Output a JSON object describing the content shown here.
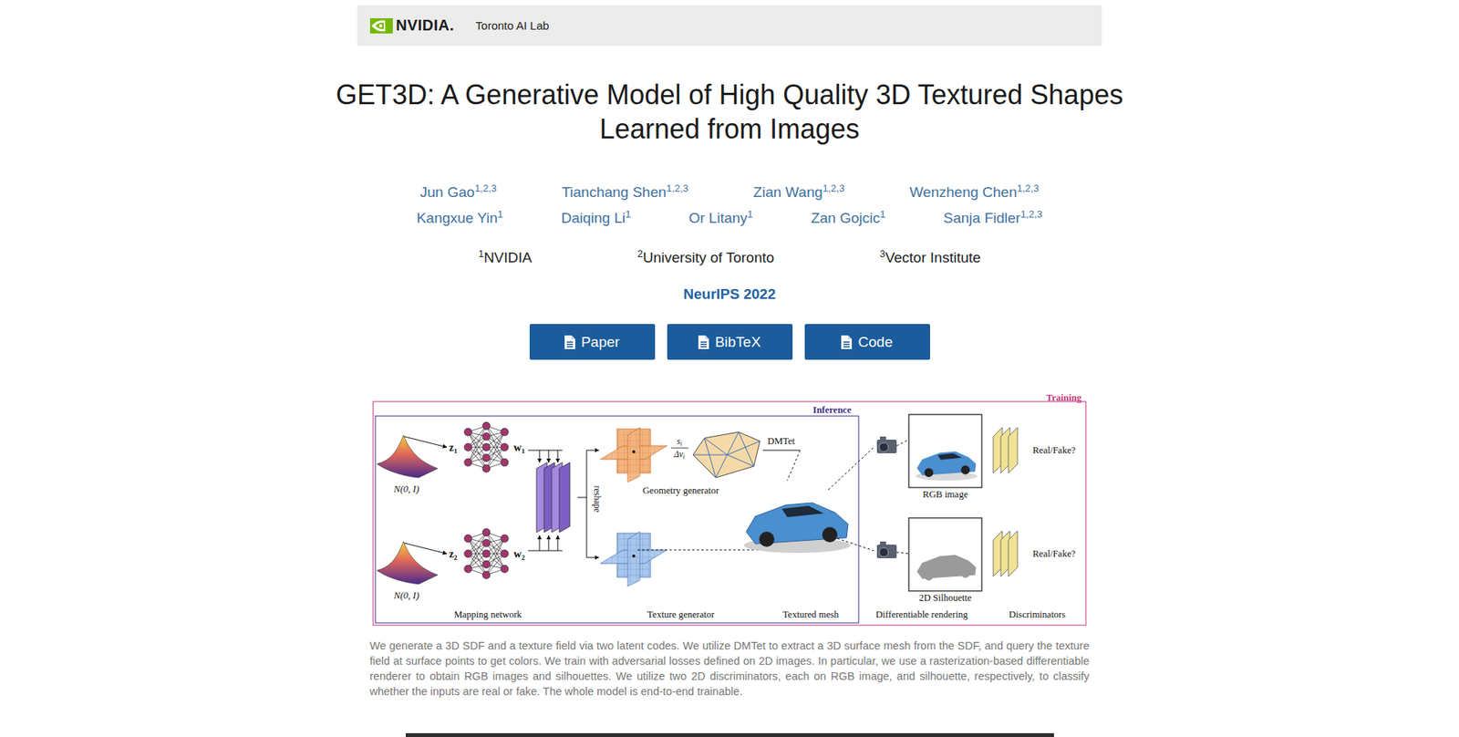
{
  "header": {
    "logo": "NVIDIA.",
    "lab": "Toronto AI Lab"
  },
  "title": "GET3D: A Generative Model of High Quality 3D Textured Shapes Learned from Images",
  "author_rows": [
    [
      {
        "name": "Jun Gao",
        "affiliations": "1,2,3"
      },
      {
        "name": "Tianchang Shen",
        "affiliations": "1,2,3"
      },
      {
        "name": "Zian Wang",
        "affiliations": "1,2,3"
      },
      {
        "name": "Wenzheng Chen",
        "affiliations": "1,2,3"
      }
    ],
    [
      {
        "name": "Kangxue Yin",
        "affiliations": "1"
      },
      {
        "name": "Daiqing Li",
        "affiliations": "1"
      },
      {
        "name": "Or Litany",
        "affiliations": "1"
      },
      {
        "name": "Zan Gojcic",
        "affiliations": "1"
      },
      {
        "name": "Sanja Fidler",
        "affiliations": "1,2,3"
      }
    ]
  ],
  "affiliations": [
    {
      "mark": "1",
      "name": "NVIDIA"
    },
    {
      "mark": "2",
      "name": "University of Toronto"
    },
    {
      "mark": "3",
      "name": "Vector Institute"
    }
  ],
  "venue": "NeurIPS 2022",
  "buttons": [
    "Paper",
    "BibTeX",
    "Code"
  ],
  "figure": {
    "training_label": "Training",
    "inference_label": "Inference",
    "latents": [
      {
        "dist": "N(0, I)",
        "z": {
          "base": "z",
          "sub": "1"
        },
        "w": {
          "base": "w",
          "sub": "1"
        }
      },
      {
        "dist": "N(0, I)",
        "z": {
          "base": "z",
          "sub": "2"
        },
        "w": {
          "base": "w",
          "sub": "2"
        }
      }
    ],
    "reshape": "reshape",
    "sdf": {
      "num": {
        "base": "s",
        "sub": "i"
      },
      "den": {
        "base": "Δv",
        "sub": "i"
      }
    },
    "geometry_label": "Geometry generator",
    "dmtet": "DMTet",
    "views": [
      {
        "kind": "rgb",
        "image_label": "RGB image",
        "discriminator_label": "Real/Fake?"
      },
      {
        "kind": "silhouette",
        "image_label": "2D Silhouette",
        "discriminator_label": "Real/Fake?"
      }
    ],
    "stage_labels": [
      "Mapping network",
      "Texture generator",
      "Textured mesh",
      "Differentiable rendering",
      "Discriminators"
    ]
  },
  "caption": "We generate a 3D SDF and a texture field via two latent codes. We utilize DMTet to extract a 3D surface mesh from the SDF, and query the texture field at surface points to get colors. We train with adversarial losses defined on 2D images. In particular, we use a rasterization-based differentiable renderer to obtain RGB images and silhouettes. We utilize two 2D discriminators, each on RGB image, and silhouette, respectively, to classify whether the inputs are real or fake. The whole model is end-to-end trainable."
}
